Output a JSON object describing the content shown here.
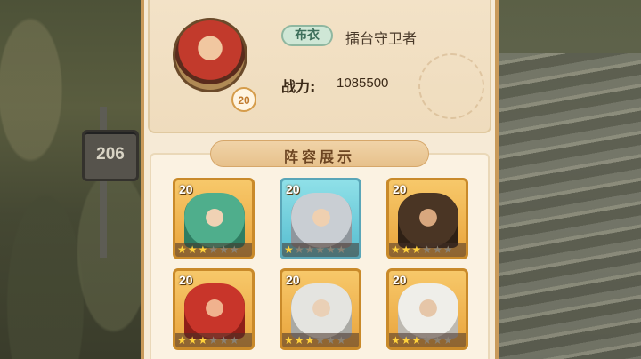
{
  "scene": {
    "stage_sign": "206"
  },
  "profile": {
    "avatar_level": "20",
    "rank_badge": "布衣",
    "player_name": "擂台守卫者",
    "power_label": "战力:",
    "power_value": "1085500"
  },
  "lineup": {
    "title": "阵容展示",
    "heroes": [
      {
        "level": "20",
        "stars": 3,
        "max_stars": 6,
        "frame": "gold",
        "portrait": "green-hair-warrior"
      },
      {
        "level": "20",
        "stars": 1,
        "max_stars": 6,
        "frame": "teal",
        "portrait": "silver-helmet-warrior"
      },
      {
        "level": "20",
        "stars": 3,
        "max_stars": 6,
        "frame": "gold",
        "portrait": "bearded-general"
      },
      {
        "level": "20",
        "stars": 3,
        "max_stars": 6,
        "frame": "gold",
        "portrait": "red-hair-warrior"
      },
      {
        "level": "20",
        "stars": 3,
        "max_stars": 6,
        "frame": "gold",
        "portrait": "white-hair-warrior"
      },
      {
        "level": "20",
        "stars": 3,
        "max_stars": 6,
        "frame": "gold",
        "portrait": "white-hair-elder"
      }
    ]
  },
  "colors": {
    "panel": "#f6ead6",
    "frame_gold": "#e9a43c",
    "frame_teal": "#56bdd0",
    "star_on": "#ffd23c",
    "star_off": "#8a8275"
  }
}
